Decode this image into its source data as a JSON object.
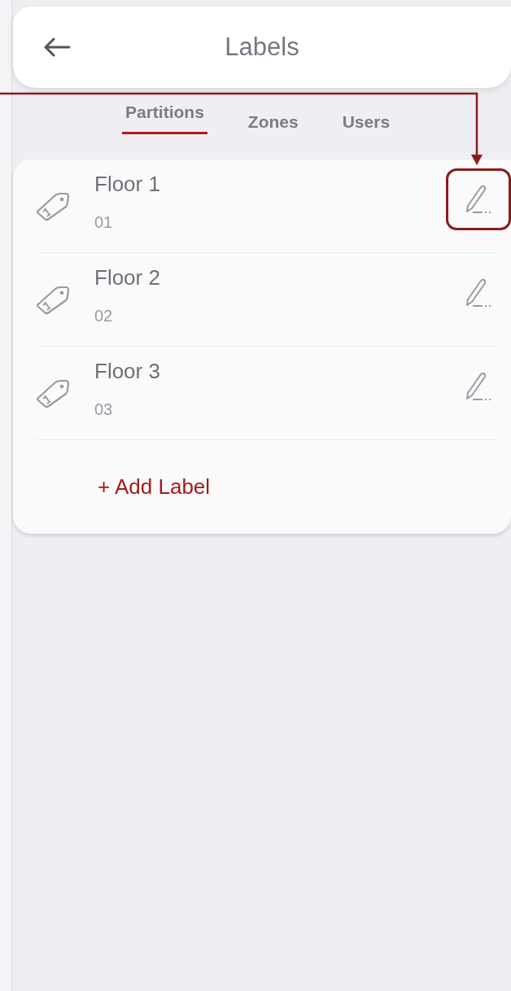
{
  "header": {
    "title": "Labels"
  },
  "tabs": [
    {
      "label": "Partitions",
      "selected": true
    },
    {
      "label": "Zones",
      "selected": false
    },
    {
      "label": "Users",
      "selected": false
    }
  ],
  "labels": [
    {
      "name": "Floor 1",
      "code": "01",
      "highlighted": true
    },
    {
      "name": "Floor 2",
      "code": "02",
      "highlighted": false
    },
    {
      "name": "Floor 3",
      "code": "03",
      "highlighted": false
    }
  ],
  "add_button": "+ Add Label"
}
